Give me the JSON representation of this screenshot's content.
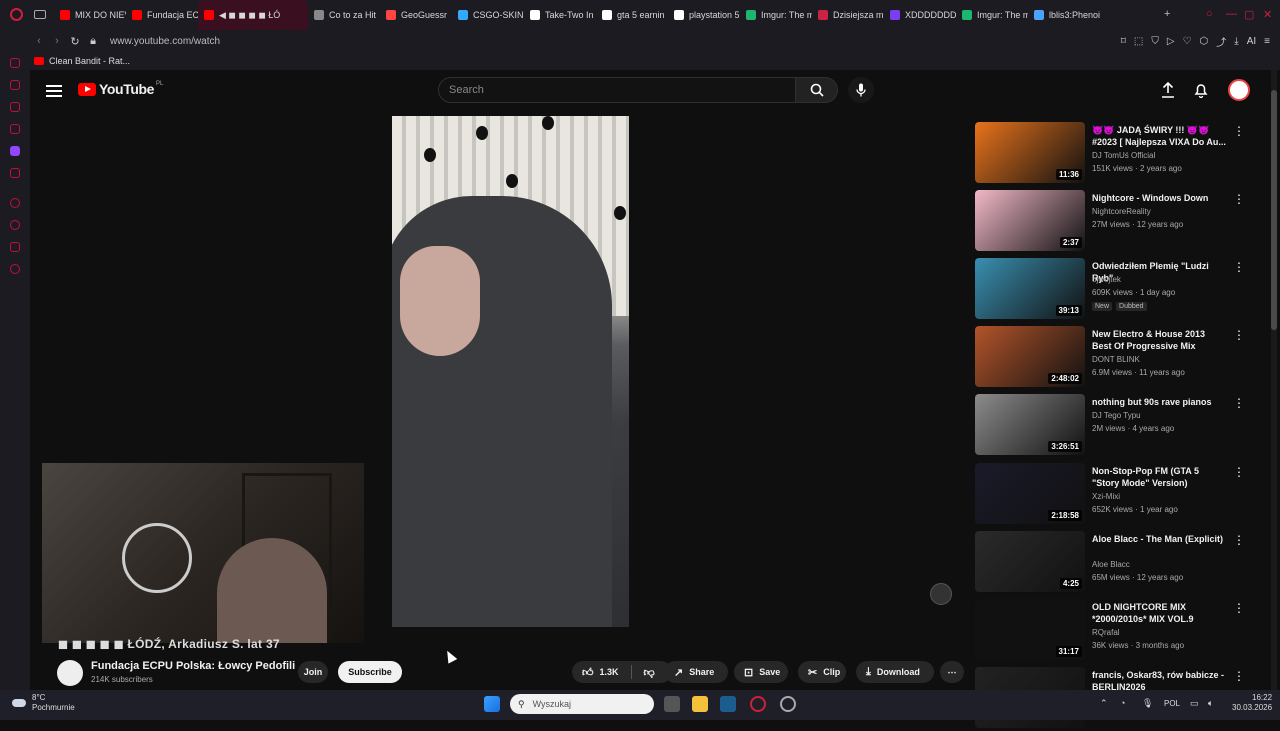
{
  "browser": {
    "tabs": [
      {
        "label": "MIX DO NIEV",
        "color": "#ff0000"
      },
      {
        "label": "Fundacja EC",
        "color": "#ff0000"
      },
      {
        "label": "◀ ◼ ◼ ◼ ◼ ŁÓ",
        "color": "#ff0000",
        "active": true
      },
      {
        "label": "Co to za Hit",
        "color": "#888888"
      },
      {
        "label": "GeoGuessr",
        "color": "#ff4444"
      },
      {
        "label": "CSGO-SKIN",
        "color": "#33aaff"
      },
      {
        "label": "Take-Two In",
        "color": "#ffffff"
      },
      {
        "label": "gta 5 earnin",
        "color": "#ffffff"
      },
      {
        "label": "playstation 5",
        "color": "#ffffff"
      },
      {
        "label": "Imgur: The m",
        "color": "#1bb76e"
      },
      {
        "label": "Dzisiejsza m",
        "color": "#cc2244"
      },
      {
        "label": "XDDDDDDD",
        "color": "#7a3ef0"
      },
      {
        "label": "Imgur: The m",
        "color": "#1bb76e"
      },
      {
        "label": "lblis3:Phenoi",
        "color": "#4aa3ff"
      }
    ],
    "url": "www.youtube.com/watch",
    "bookmark": "Clean Bandit - Rat..."
  },
  "header": {
    "logo": "YouTube",
    "logo_region": "PL",
    "search_placeholder": "Search"
  },
  "video": {
    "ticker": "◼ ◼ ◼ ◼ ◼ ŁÓDŹ, Arkadiusz S. lat 37",
    "channel": "Fundacja ECPU Polska: Łowcy Pedofili",
    "subscribers": "214K subscribers",
    "join": "Join",
    "subscribe": "Subscribe",
    "likes": "1.3K",
    "share": "Share",
    "save": "Save",
    "clip": "Clip",
    "download": "Download"
  },
  "recommendations": [
    {
      "title": "😈😈 JADĄ ŚWIRY !!! 😈😈 #2023 [ Najlepsza VIXA Do Au...",
      "channel": "DJ TomUś Official",
      "meta": "151K views · 2 years ago",
      "duration": "11:36",
      "color": "#e8731c"
    },
    {
      "title": "Nightcore - Windows Down",
      "channel": "NightcoreReality",
      "meta": "27M views · 12 years ago",
      "duration": "2:37",
      "color": "#f2b8c8"
    },
    {
      "title": "Odwiedziłem Plemię \"Ludzi Ryb\"",
      "channel": "ojwojtek",
      "meta": "609K views · 1 day ago",
      "badges": [
        "New",
        "Dubbed"
      ],
      "duration": "39:13",
      "color": "#3a8fb0"
    },
    {
      "title": "New Electro & House 2013 Best Of Progressive Mix",
      "channel": "DONT BLINK",
      "meta": "6.9M views · 11 years ago",
      "duration": "2:48:02",
      "color": "#b3542a"
    },
    {
      "title": "nothing but 90s rave pianos",
      "channel": "DJ Tego Typu",
      "meta": "2M views · 4 years ago",
      "duration": "3:26:51",
      "color": "#8c8c8c"
    },
    {
      "title": "Non-Stop-Pop FM (GTA 5 \"Story Mode\" Version)",
      "channel": "Xzi-Mixi",
      "meta": "652K views · 1 year ago",
      "duration": "2:18:58",
      "color": "#1a1a2a"
    },
    {
      "title": "Aloe Blacc - The Man (Explicit)",
      "channel": "Aloe Blacc",
      "meta": "65M views · 12 years ago",
      "duration": "4:25",
      "color": "#2b2b2b"
    },
    {
      "title": "OLD NIGHTCORE MIX *2000/2010s* MIX VOL.9",
      "channel": "RQrafal",
      "meta": "36K views · 3 months ago",
      "duration": "31:17",
      "color": "#111111"
    },
    {
      "title": "francis, Oskar83, rów babicze - BERLIN2026",
      "channel": "",
      "meta": "",
      "duration": "",
      "color": "#222222"
    }
  ],
  "taskbar": {
    "temperature": "8°C",
    "weather": "Pochmurnie",
    "search_placeholder": "Wyszukaj",
    "lang": "POL",
    "time": "16:22",
    "date": "30.03.2026"
  }
}
